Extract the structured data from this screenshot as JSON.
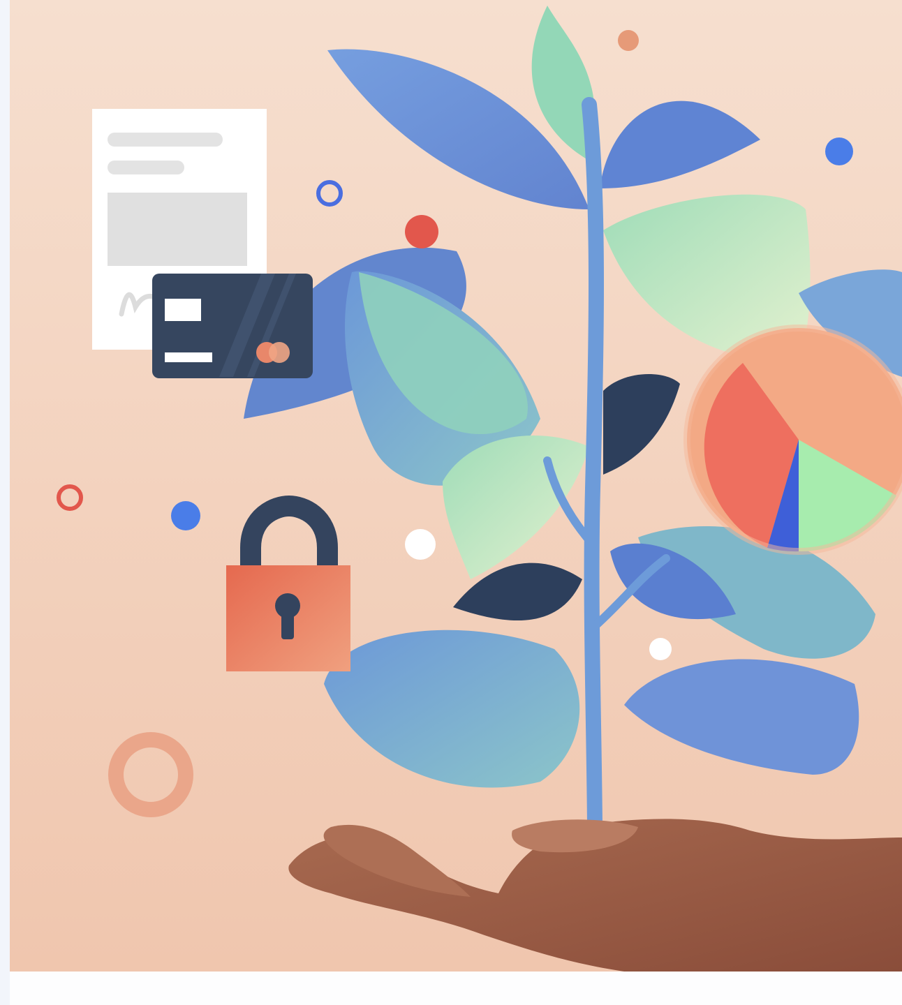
{
  "illustration": {
    "alt": "",
    "colors": {
      "background_top": "#f6dccb",
      "background_bottom": "#efc4ad",
      "leaf_blue": "#5b86d6",
      "leaf_teal": "#7fb8c7",
      "leaf_mint": "#b9e6c4",
      "leaf_dark": "#2d3f5c",
      "stem": "#6d9bd9",
      "hand": "#9a5a45",
      "hand_highlight": "#b97c62",
      "card": "#36465f",
      "lock_body": "#e2765c",
      "lock_shackle": "#34445e",
      "pie_red": "#ee6f5f",
      "pie_peach": "#f3a985",
      "pie_green": "#a7ecae",
      "pie_blue": "#3e5fd8",
      "dot_blue": "#4a7de8",
      "dot_red": "#e2574c",
      "dot_orange": "#e69a78",
      "document": "#ffffff"
    },
    "icons": [
      "document-icon",
      "credit-card-icon",
      "padlock-icon",
      "pie-chart-icon",
      "plant-icon",
      "hand-icon"
    ]
  }
}
